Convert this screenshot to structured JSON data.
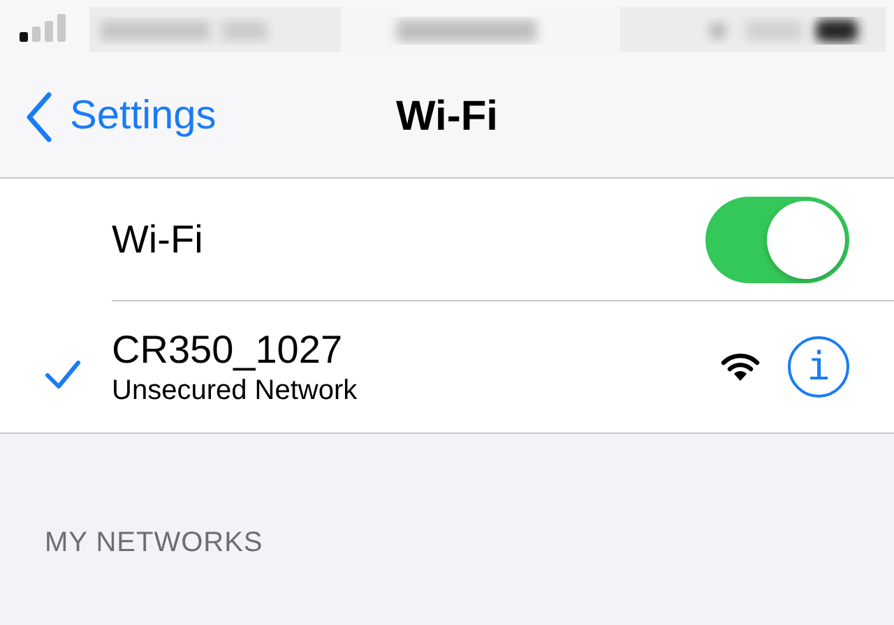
{
  "nav": {
    "back": "Settings",
    "title": "Wi-Fi"
  },
  "wifi": {
    "label": "Wi-Fi",
    "on": true
  },
  "network": {
    "name": "CR350_1027",
    "detail": "Unsecured Network",
    "selected": true,
    "info": "i"
  },
  "section": "MY NETWORKS"
}
